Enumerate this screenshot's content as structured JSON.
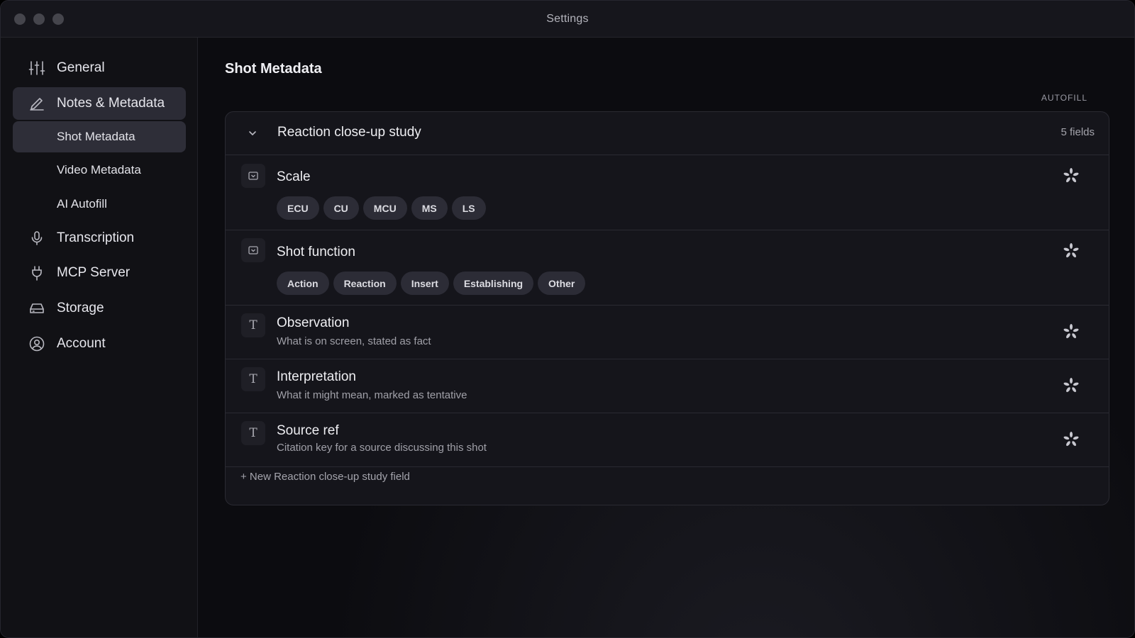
{
  "window": {
    "title": "Settings"
  },
  "sidebar": {
    "items": [
      {
        "label": "General",
        "icon": "sliders-icon"
      },
      {
        "label": "Notes & Metadata",
        "icon": "pen-icon",
        "active": true
      },
      {
        "label": "Transcription",
        "icon": "microphone-icon"
      },
      {
        "label": "MCP Server",
        "icon": "plug-icon"
      },
      {
        "label": "Storage",
        "icon": "drive-icon"
      },
      {
        "label": "Account",
        "icon": "user-circle-icon"
      }
    ],
    "subitems": [
      {
        "label": "Shot Metadata",
        "active": true
      },
      {
        "label": "Video Metadata"
      },
      {
        "label": "AI Autofill"
      }
    ]
  },
  "main": {
    "title": "Shot Metadata",
    "autofill_label": "AUTOFILL",
    "group": {
      "title": "Reaction close-up study",
      "count": "5 fields",
      "fields": [
        {
          "name": "Scale",
          "type": "select",
          "options": [
            "ECU",
            "CU",
            "MCU",
            "MS",
            "LS"
          ]
        },
        {
          "name": "Shot function",
          "type": "select",
          "options": [
            "Action",
            "Reaction",
            "Insert",
            "Establishing",
            "Other"
          ]
        },
        {
          "name": "Observation",
          "type": "text",
          "description": "What is on screen, stated as fact"
        },
        {
          "name": "Interpretation",
          "type": "text",
          "description": "What it might mean, marked as tentative"
        },
        {
          "name": "Source ref",
          "type": "text",
          "description": "Citation key for a source discussing this shot"
        }
      ],
      "add_field": "+ New Reaction close-up study field"
    }
  },
  "colors": {
    "background": "#0c0c10",
    "active_item": "#2b2b35",
    "chip": "#2c2c36"
  }
}
